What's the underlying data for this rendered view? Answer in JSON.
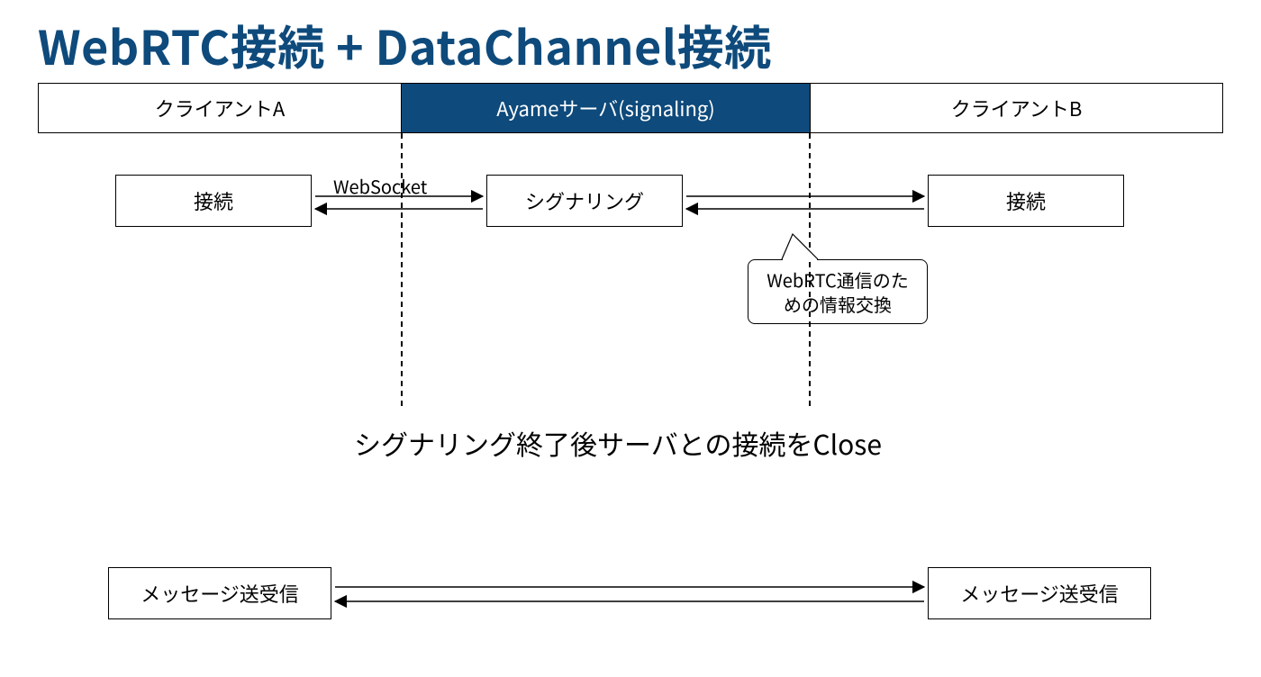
{
  "title": "WebRTC接続 + DataChannel接続",
  "header": {
    "clientA": "クライアントA",
    "server": "Ayameサーバ(signaling)",
    "clientB": "クライアントB"
  },
  "row1": {
    "leftBox": "接続",
    "wsLabel": "WebSocket",
    "centerBox": "シグナリング",
    "rightBox": "接続"
  },
  "callout": {
    "line1": "WebRTC通信のた",
    "line2": "めの情報交換"
  },
  "midText": "シグナリング終了後サーバとの接続をClose",
  "row2": {
    "leftBox": "メッセージ送受信",
    "rightBox": "メッセージ送受信"
  }
}
